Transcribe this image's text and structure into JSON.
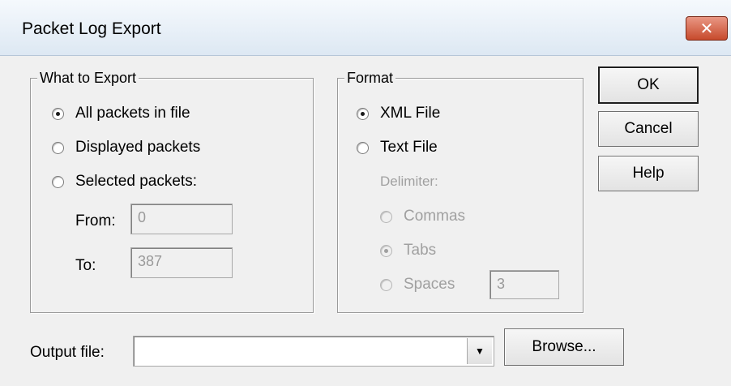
{
  "window": {
    "title": "Packet Log Export",
    "close_glyph": "✕"
  },
  "what_to_export": {
    "legend": "What to Export",
    "options": [
      {
        "label": "All packets in file",
        "checked": true
      },
      {
        "label": "Displayed packets",
        "checked": false
      },
      {
        "label": "Selected packets:",
        "checked": false
      }
    ],
    "from_label": "From:",
    "from_value": "0",
    "to_label": "To:",
    "to_value": "387"
  },
  "format": {
    "legend": "Format",
    "options": [
      {
        "label": "XML File",
        "checked": true
      },
      {
        "label": "Text File",
        "checked": false
      }
    ],
    "delimiter_label": "Delimiter:",
    "delimiters": [
      {
        "label": "Commas",
        "checked": false
      },
      {
        "label": "Tabs",
        "checked": true
      },
      {
        "label": "Spaces",
        "checked": false
      }
    ],
    "spaces_value": "3"
  },
  "buttons": {
    "ok": "OK",
    "cancel": "Cancel",
    "help": "Help",
    "browse": "Browse..."
  },
  "output": {
    "label": "Output file:",
    "value": "",
    "dropdown_glyph": "▼"
  }
}
